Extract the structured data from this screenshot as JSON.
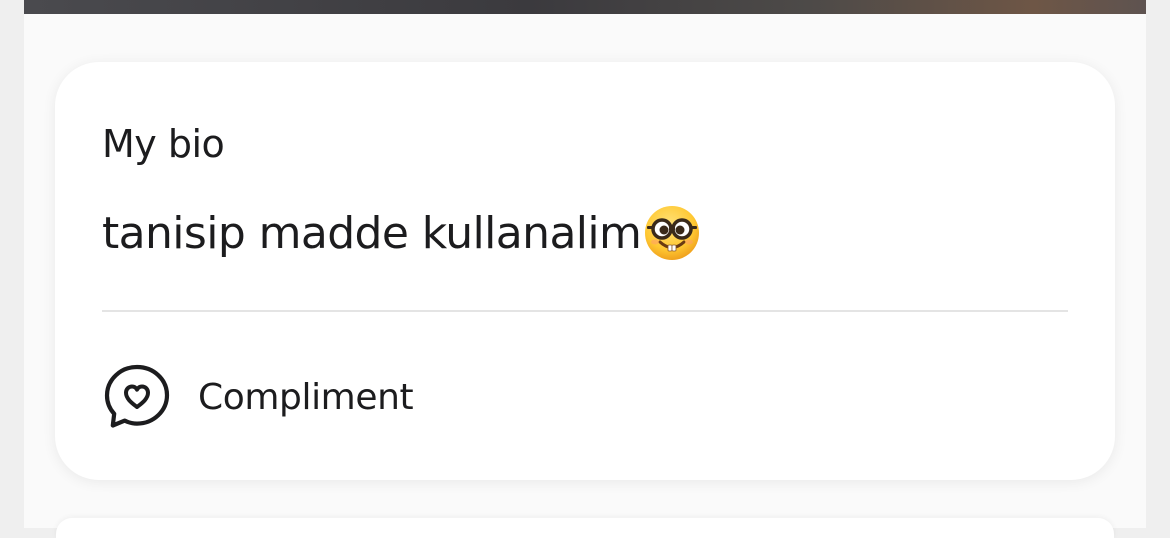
{
  "bio_card": {
    "heading": "My bio",
    "text": "tanisip madde kullanalim",
    "emoji_icon": "nerd-face-icon"
  },
  "actions": {
    "compliment_label": "Compliment",
    "compliment_icon": "heart-speech-bubble-icon"
  },
  "colors": {
    "text": "#1c1c1e",
    "card_background": "#ffffff",
    "page_background": "#efefef",
    "divider": "#e4e4e4"
  }
}
